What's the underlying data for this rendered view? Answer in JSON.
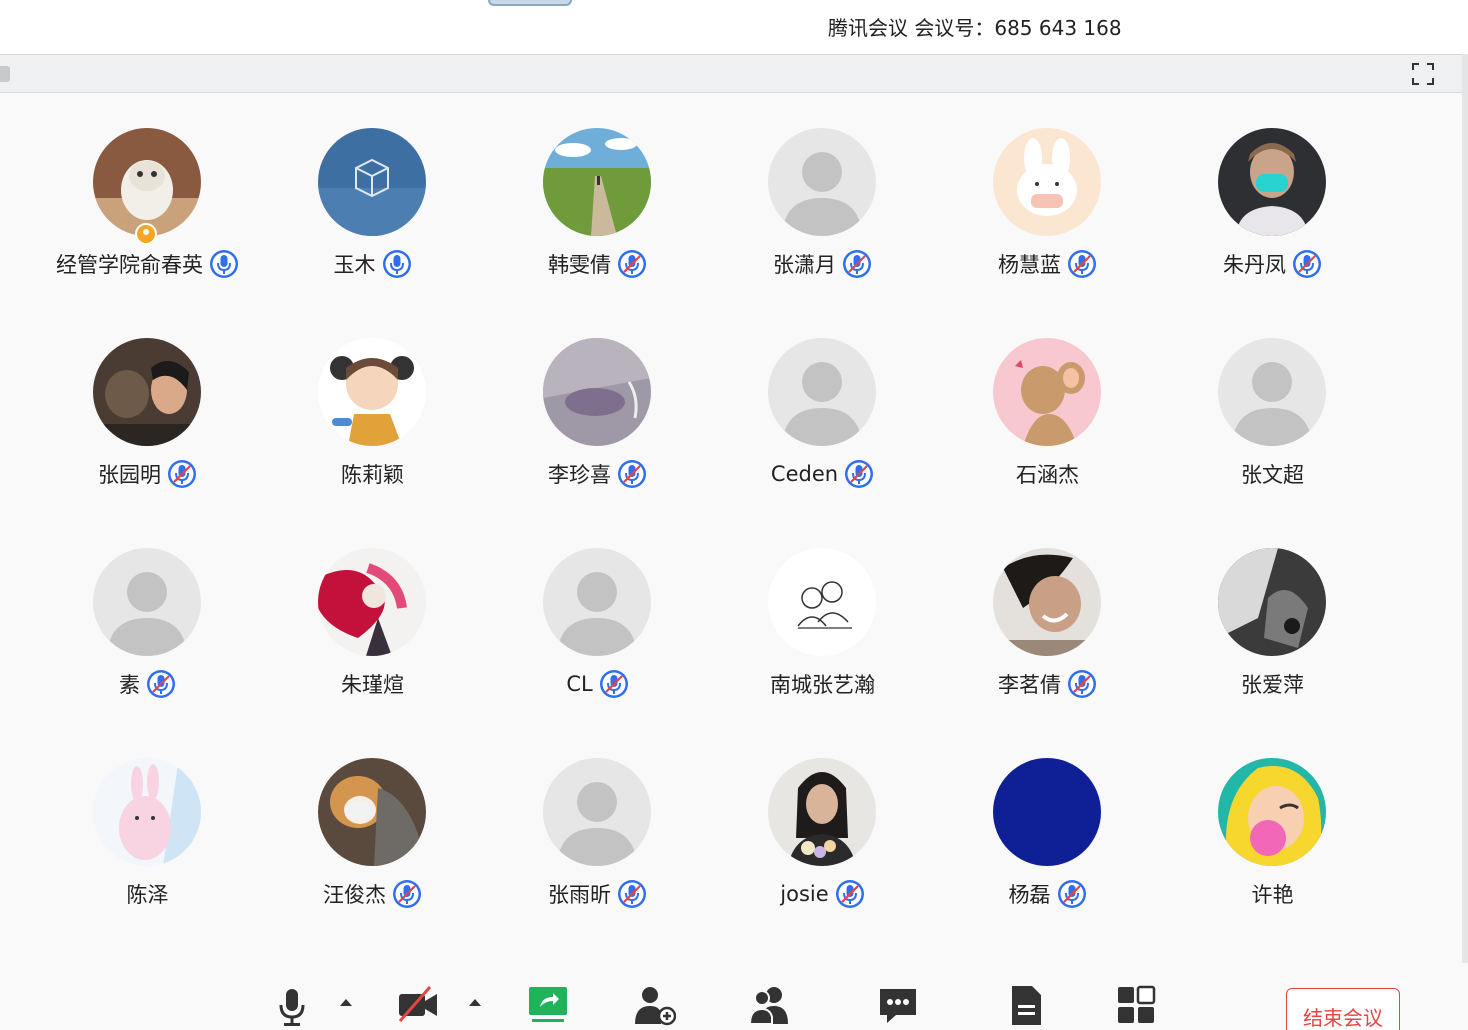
{
  "window": {
    "title": "腾讯会议 会议号：685 643 168"
  },
  "participants": [
    {
      "name": "经管学院俞春英",
      "mic": "on",
      "host": true,
      "avatar": "cat-photo"
    },
    {
      "name": "玉木",
      "mic": "on",
      "host": false,
      "avatar": "glass-cube"
    },
    {
      "name": "韩雯倩",
      "mic": "muted",
      "host": false,
      "avatar": "landscape-path"
    },
    {
      "name": "张潇月",
      "mic": "muted",
      "host": false,
      "avatar": "default"
    },
    {
      "name": "杨慧蓝",
      "mic": "muted",
      "host": false,
      "avatar": "bunny-mask"
    },
    {
      "name": "朱丹凤",
      "mic": "muted",
      "host": false,
      "avatar": "person-mask"
    },
    {
      "name": "张园明",
      "mic": "muted",
      "host": false,
      "avatar": "dog-selfie"
    },
    {
      "name": "陈莉颖",
      "mic": "none",
      "host": false,
      "avatar": "cartoon-boy"
    },
    {
      "name": "李珍喜",
      "mic": "muted",
      "host": false,
      "avatar": "purple-scene"
    },
    {
      "name": "Ceden",
      "mic": "muted",
      "host": false,
      "avatar": "default"
    },
    {
      "name": "石涵杰",
      "mic": "none",
      "host": false,
      "avatar": "cartoon-mouse"
    },
    {
      "name": "张文超",
      "mic": "none",
      "host": false,
      "avatar": "default"
    },
    {
      "name": "素",
      "mic": "muted",
      "host": false,
      "avatar": "default"
    },
    {
      "name": "朱瑾煊",
      "mic": "none",
      "host": false,
      "avatar": "red-character"
    },
    {
      "name": "CL",
      "mic": "muted",
      "host": false,
      "avatar": "default"
    },
    {
      "name": "南城张艺瀚",
      "mic": "none",
      "host": false,
      "avatar": "sketch-couple"
    },
    {
      "name": "李茗倩",
      "mic": "muted",
      "host": false,
      "avatar": "smiling-girl"
    },
    {
      "name": "张爱萍",
      "mic": "none",
      "host": false,
      "avatar": "bw-photo"
    },
    {
      "name": "陈泽",
      "mic": "none",
      "host": false,
      "avatar": "pink-rabbit"
    },
    {
      "name": "汪俊杰",
      "mic": "muted",
      "host": false,
      "avatar": "shiba-mask"
    },
    {
      "name": "张雨昕",
      "mic": "muted",
      "host": false,
      "avatar": "default"
    },
    {
      "name": "josie",
      "mic": "muted",
      "host": false,
      "avatar": "girl-flowers"
    },
    {
      "name": "杨磊",
      "mic": "muted",
      "host": false,
      "avatar": "solid-blue"
    },
    {
      "name": "许艳",
      "mic": "none",
      "host": false,
      "avatar": "pop-art-girl"
    }
  ],
  "toolbar": {
    "end_meeting_label": "结束会议"
  },
  "colors": {
    "accent_blue": "#2f6fee",
    "end_red": "#e54545",
    "share_green": "#1fb45a",
    "default_avatar_bg": "#e6e6e6",
    "default_avatar_fg": "#c3c3c3"
  }
}
